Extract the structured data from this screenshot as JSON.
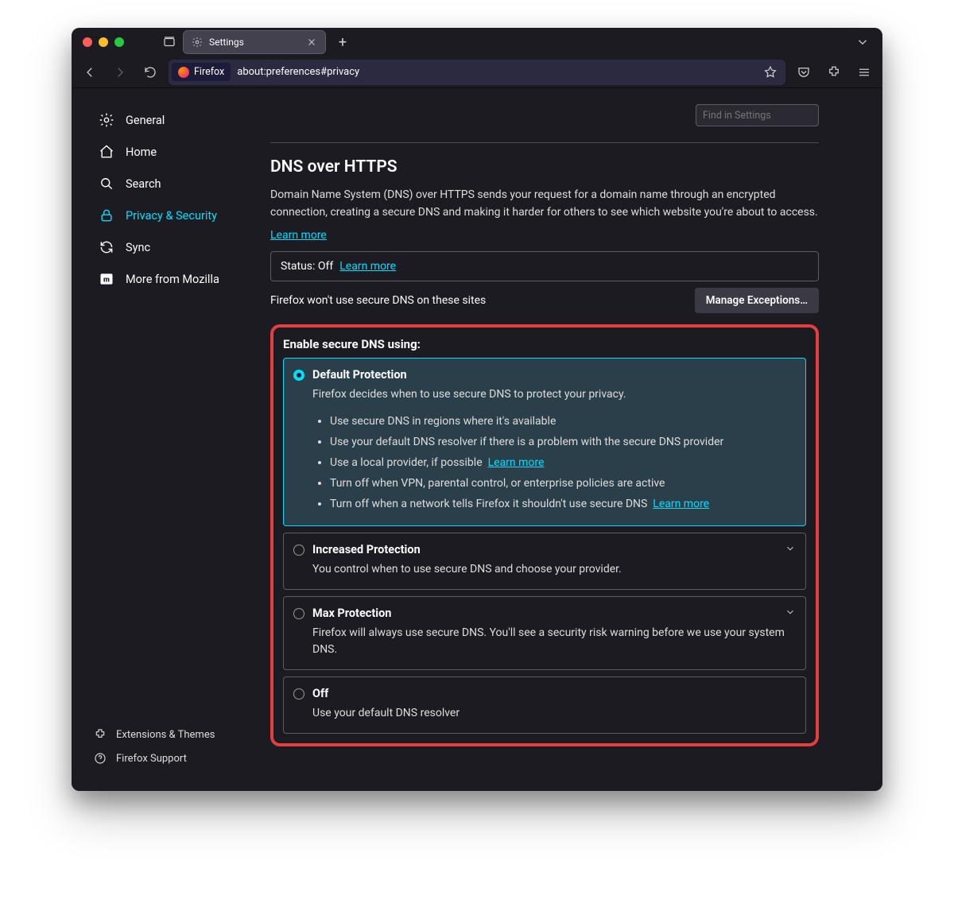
{
  "tab": {
    "title": "Settings"
  },
  "urlbar": {
    "chip": "Firefox",
    "address": "about:preferences#privacy"
  },
  "sidebar": {
    "items": [
      {
        "label": "General"
      },
      {
        "label": "Home"
      },
      {
        "label": "Search"
      },
      {
        "label": "Privacy & Security"
      },
      {
        "label": "Sync"
      },
      {
        "label": "More from Mozilla"
      }
    ],
    "bottom": [
      {
        "label": "Extensions & Themes"
      },
      {
        "label": "Firefox Support"
      }
    ]
  },
  "find": {
    "placeholder": "Find in Settings"
  },
  "section": {
    "title": "DNS over HTTPS",
    "desc": "Domain Name System (DNS) over HTTPS sends your request for a domain name through an encrypted connection, creating a secure DNS and making it harder for others to see which website you're about to access.",
    "learn": "Learn more",
    "status_label": "Status: Off",
    "status_learn": "Learn more",
    "exceptions_text": "Firefox won't use secure DNS on these sites",
    "exceptions_btn": "Manage Exceptions…"
  },
  "dns": {
    "enable_title": "Enable secure DNS using:",
    "options": [
      {
        "title": "Default Protection",
        "sub": "Firefox decides when to use secure DNS to protect your privacy.",
        "bullets": [
          {
            "text": "Use secure DNS in regions where it's available"
          },
          {
            "text": "Use your default DNS resolver if there is a problem with the secure DNS provider"
          },
          {
            "text": "Use a local provider, if possible",
            "link": "Learn more"
          },
          {
            "text": "Turn off when VPN, parental control, or enterprise policies are active"
          },
          {
            "text": "Turn off when a network tells Firefox it shouldn't use secure DNS",
            "link": "Learn more"
          }
        ]
      },
      {
        "title": "Increased Protection",
        "sub": "You control when to use secure DNS and choose your provider."
      },
      {
        "title": "Max Protection",
        "sub": "Firefox will always use secure DNS. You'll see a security risk warning before we use your system DNS."
      },
      {
        "title": "Off",
        "sub": "Use your default DNS resolver"
      }
    ]
  }
}
